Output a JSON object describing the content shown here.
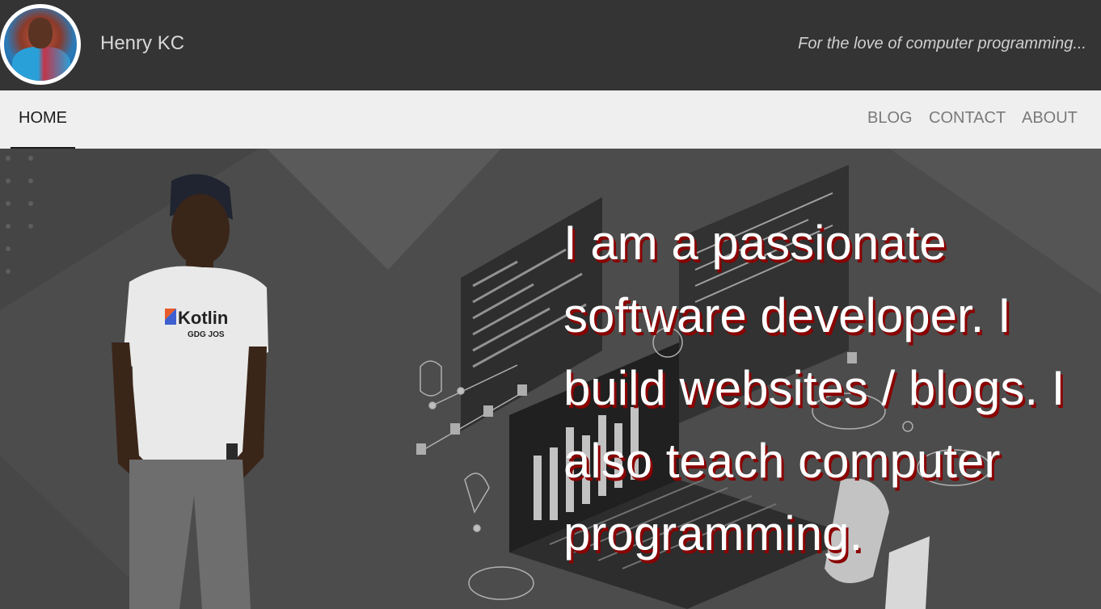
{
  "header": {
    "site_title": "Henry KC",
    "tagline": "For the love of computer programming..."
  },
  "nav": {
    "home": "HOME",
    "blog": "BLOG",
    "contact": "CONTACT",
    "about": "ABOUT"
  },
  "hero": {
    "headline": "I am a passionate software developer. I build websites / blogs. I also teach computer programming.",
    "shirt_logo_text": "Kotlin",
    "shirt_sub_text": "GDG JOS"
  },
  "colors": {
    "header_bg": "#343434",
    "nav_bg": "#efefef",
    "hero_bg": "#4c4c4c",
    "headline_shadow": "#8b0000"
  }
}
